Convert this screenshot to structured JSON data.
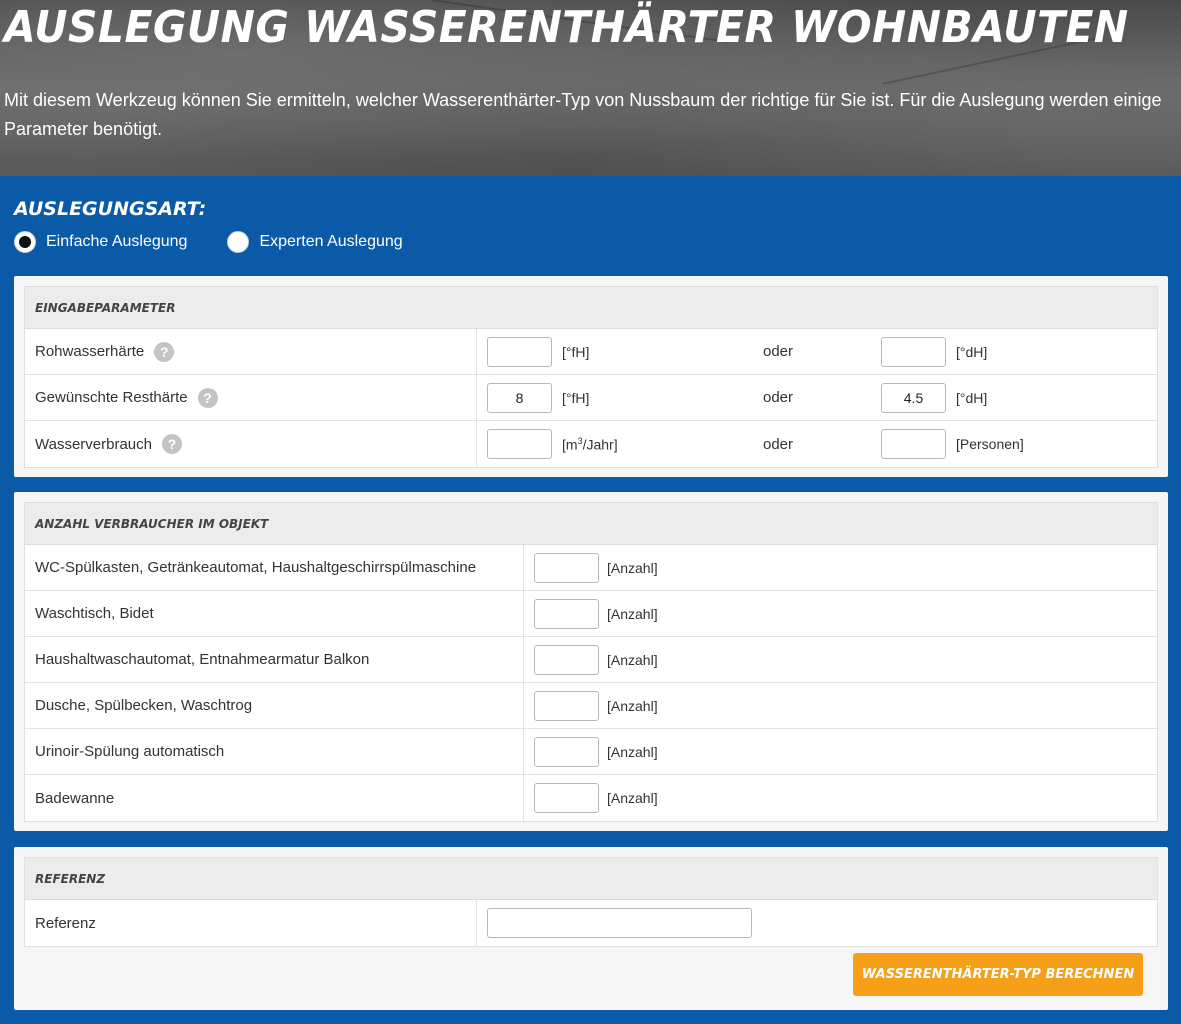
{
  "header": {
    "title": "AUSLEGUNG WASSERENTHÄRTER WOHNBAUTEN",
    "intro": "Mit diesem Werkzeug können Sie ermitteln, welcher Wasserenthärter-Typ von Nussbaum der richtige für Sie ist. Für die Auslegung werden einige Parameter benötigt."
  },
  "auslegungsart": {
    "title": "AUSLEGUNGSART:",
    "options": [
      {
        "label": "Einfache Auslegung",
        "selected": true
      },
      {
        "label": "Experten Auslegung",
        "selected": false
      }
    ]
  },
  "eingabeparameter": {
    "heading": "EINGABEPARAMETER",
    "oder": "oder",
    "rows": [
      {
        "label": "Rohwasserhärte",
        "value1": "",
        "unit1": "[°fH]",
        "value2": "",
        "unit2": "[°dH]"
      },
      {
        "label": "Gewünschte Resthärte",
        "value1": "8",
        "unit1": "[°fH]",
        "value2": "4.5",
        "unit2": "[°dH]"
      },
      {
        "label": "Wasserverbrauch",
        "value1": "",
        "unit1_pre": "[m",
        "unit1_sup": "3",
        "unit1_post": "/Jahr]",
        "value2": "",
        "unit2": "[Personen]"
      }
    ],
    "help_glyph": "?"
  },
  "verbraucher": {
    "heading": "ANZAHL VERBRAUCHER IM OBJEKT",
    "unit": "[Anzahl]",
    "rows": [
      {
        "label": "WC-Spülkasten, Getränkeautomat, Haushaltgeschirrspülmaschine",
        "value": ""
      },
      {
        "label": "Waschtisch, Bidet",
        "value": ""
      },
      {
        "label": "Haushaltwaschautomat, Entnahmearmatur Balkon",
        "value": ""
      },
      {
        "label": "Dusche, Spülbecken, Waschtrog",
        "value": ""
      },
      {
        "label": "Urinoir-Spülung automatisch",
        "value": ""
      },
      {
        "label": "Badewanne",
        "value": ""
      }
    ]
  },
  "referenz": {
    "heading": "REFERENZ",
    "label": "Referenz",
    "value": ""
  },
  "actions": {
    "calculate_label": "WASSERENTHÄRTER-TYP BERECHNEN"
  },
  "colors": {
    "brand_blue": "#0a5aa8",
    "button_orange": "#f6a01a"
  }
}
